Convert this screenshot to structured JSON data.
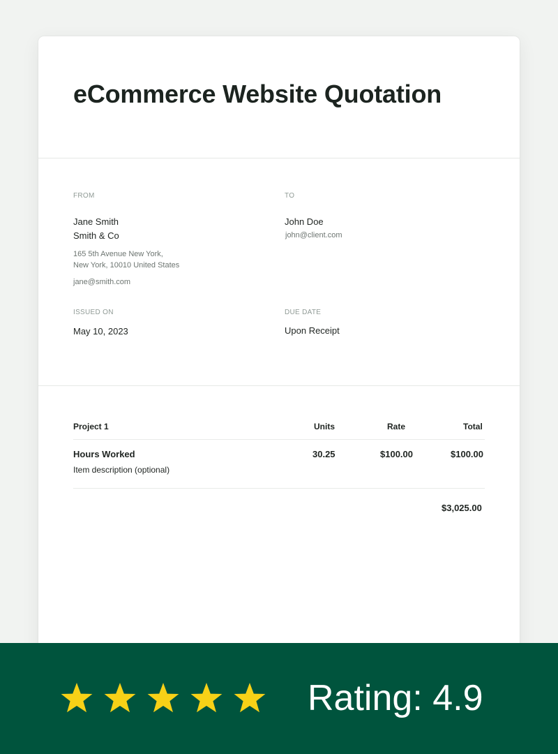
{
  "document": {
    "title": "eCommerce Website Quotation"
  },
  "from": {
    "label": "FROM",
    "name": "Jane Smith",
    "company": "Smith & Co",
    "address_line1": "165 5th Avenue New York,",
    "address_line2": "New York, 10010 United States",
    "email": "jane@smith.com"
  },
  "to": {
    "label": "TO",
    "name": "John Doe",
    "email": "john@client.com"
  },
  "issued": {
    "label": "ISSUED ON",
    "value": "May 10, 2023"
  },
  "due": {
    "label": "DUE DATE",
    "value": "Upon Receipt"
  },
  "table": {
    "headers": [
      "Project 1",
      "Units",
      "Rate",
      "Total"
    ],
    "rows": [
      {
        "item": "Hours Worked",
        "description": "Item description (optional)",
        "units": "30.25",
        "rate": "$100.00",
        "total": "$100.00"
      }
    ],
    "grand_total": "$3,025.00"
  },
  "rating": {
    "stars": 5,
    "star_color": "#f7d117",
    "banner_color": "#00543d",
    "text": "Rating: 4.9"
  }
}
